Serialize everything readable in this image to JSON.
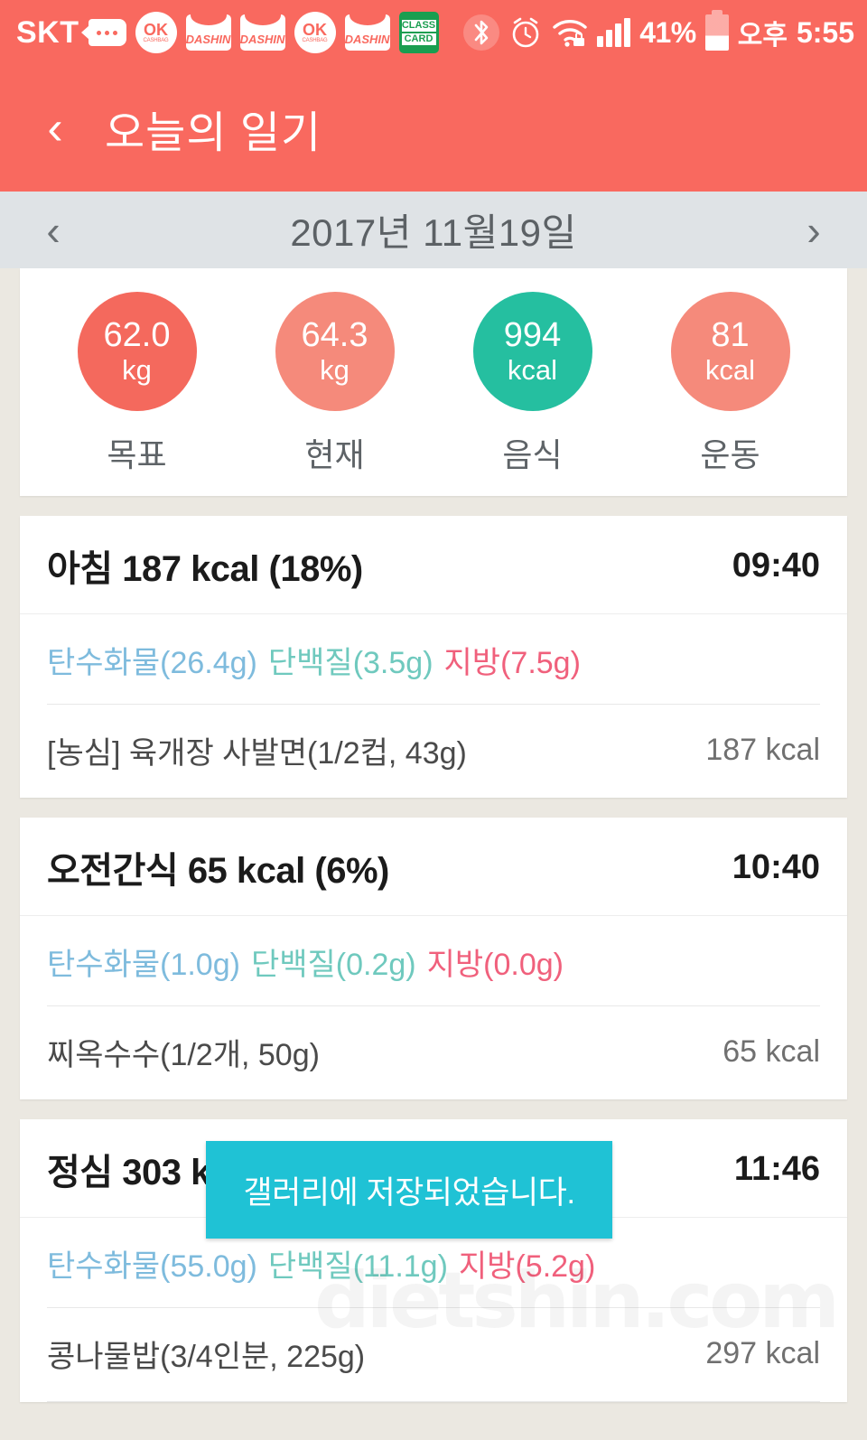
{
  "statusbar": {
    "carrier": "SKT",
    "icons": [
      {
        "name": "message-icon",
        "label": "•••"
      },
      {
        "name": "ok-cashbag-icon",
        "big": "OK",
        "small": "CASHBAG"
      },
      {
        "name": "dashin-icon",
        "label": "DASHIN"
      },
      {
        "name": "dashin-icon",
        "label": "DASHIN"
      },
      {
        "name": "ok-cashbag-icon",
        "big": "OK",
        "small": "CASHBAG"
      },
      {
        "name": "dashin-icon",
        "label": "DASHIN"
      }
    ],
    "class_card": {
      "line1": "CLASS",
      "line2": "CARD"
    },
    "bluetooth_glyph": "ᛦ",
    "alarm_glyph": "⏰",
    "wifi_glyph": "ᴴ",
    "battery_percent": "41%",
    "ampm": "오후",
    "time": "5:55"
  },
  "appbar": {
    "back_glyph": "‹",
    "title": "오늘의 일기"
  },
  "datebar": {
    "prev_glyph": "‹",
    "next_glyph": "›",
    "date": "2017년 11월19일"
  },
  "summary": {
    "stats": [
      {
        "value": "62.0",
        "unit": "kg",
        "label": "목표",
        "color": "#F4695D"
      },
      {
        "value": "64.3",
        "unit": "kg",
        "label": "현재",
        "color": "#F58A7B"
      },
      {
        "value": "994",
        "unit": "kcal",
        "label": "음식",
        "color": "#25BFA0"
      },
      {
        "value": "81",
        "unit": "kcal",
        "label": "운동",
        "color": "#F58A7B"
      }
    ]
  },
  "meals": [
    {
      "title": "아침 187 kcal (18%)",
      "time": "09:40",
      "carb": "탄수화물(26.4g)",
      "protein": "단백질(3.5g)",
      "fat": "지방(7.5g)",
      "foods": [
        {
          "name": "[농심] 육개장 사발면(1/2컵, 43g)",
          "kcal": "187 kcal"
        }
      ]
    },
    {
      "title": "오전간식 65 kcal (6%)",
      "time": "10:40",
      "carb": "탄수화물(1.0g)",
      "protein": "단백질(0.2g)",
      "fat": "지방(0.0g)",
      "foods": [
        {
          "name": "찌옥수수(1/2개, 50g)",
          "kcal": "65 kcal"
        }
      ]
    },
    {
      "title": "정심 303 kcal (30%)",
      "time": "11:46",
      "carb": "탄수화물(55.0g)",
      "protein": "단백질(11.1g)",
      "fat": "지방(5.2g)",
      "foods": [
        {
          "name": "콩나물밥(3/4인분, 225g)",
          "kcal": "297 kcal"
        }
      ]
    }
  ],
  "toast": {
    "message": "갤러리에 저장되었습니다."
  },
  "watermark": {
    "text": "dietshin.com"
  }
}
